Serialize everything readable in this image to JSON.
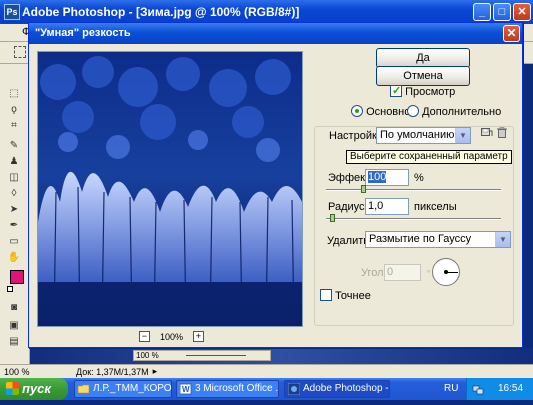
{
  "photoshop": {
    "title": "Adobe Photoshop - [Зима.jpg @ 100% (RGB/8#)]",
    "menu_fragment": "Фа",
    "status": {
      "zoom": "100 %",
      "doc": "Док: 1,37M/1,37M",
      "nav_zoom": "100 %"
    }
  },
  "dialog": {
    "title": "\"Умная\" резкость",
    "ok_label": "Да",
    "cancel_label": "Отмена",
    "preview_label": "Просмотр",
    "preview_checked": true,
    "mode_basic_label": "Основной",
    "mode_advanced_label": "Дополнительно",
    "mode_selected": "basic",
    "settings_label": "Настройки:",
    "settings_value": "По умолчанию",
    "tooltip": "Выберите сохраненный параметр",
    "amount_label": "Эффект:",
    "amount_value": "100",
    "amount_unit": "%",
    "amount_fraction": 0.2,
    "radius_label": "Радиус:",
    "radius_value": "1,0",
    "radius_unit": "пикселы",
    "radius_fraction": 0.02,
    "remove_label": "Удалить:",
    "remove_value": "Размытие по Гауссу",
    "angle_label": "Угол:",
    "angle_value": "0",
    "more_accurate_label": "Точнее",
    "more_accurate_checked": false,
    "zoom_minus": "−",
    "zoom_value": "100%",
    "zoom_plus": "+"
  },
  "taskbar": {
    "start_label": "пуск",
    "items": [
      {
        "label": "Л.Р._ТММ_КОРОТАЕВ",
        "active": false
      },
      {
        "label": "3 Microsoft Office ...",
        "active": false
      },
      {
        "label": "Adobe Photoshop - [...",
        "active": true
      }
    ],
    "language": "RU",
    "clock": "16:54"
  },
  "colors": {
    "accent": "#0a46d4",
    "foreground_color": "#e0137b",
    "dialog_bg": "#ece9d8"
  }
}
